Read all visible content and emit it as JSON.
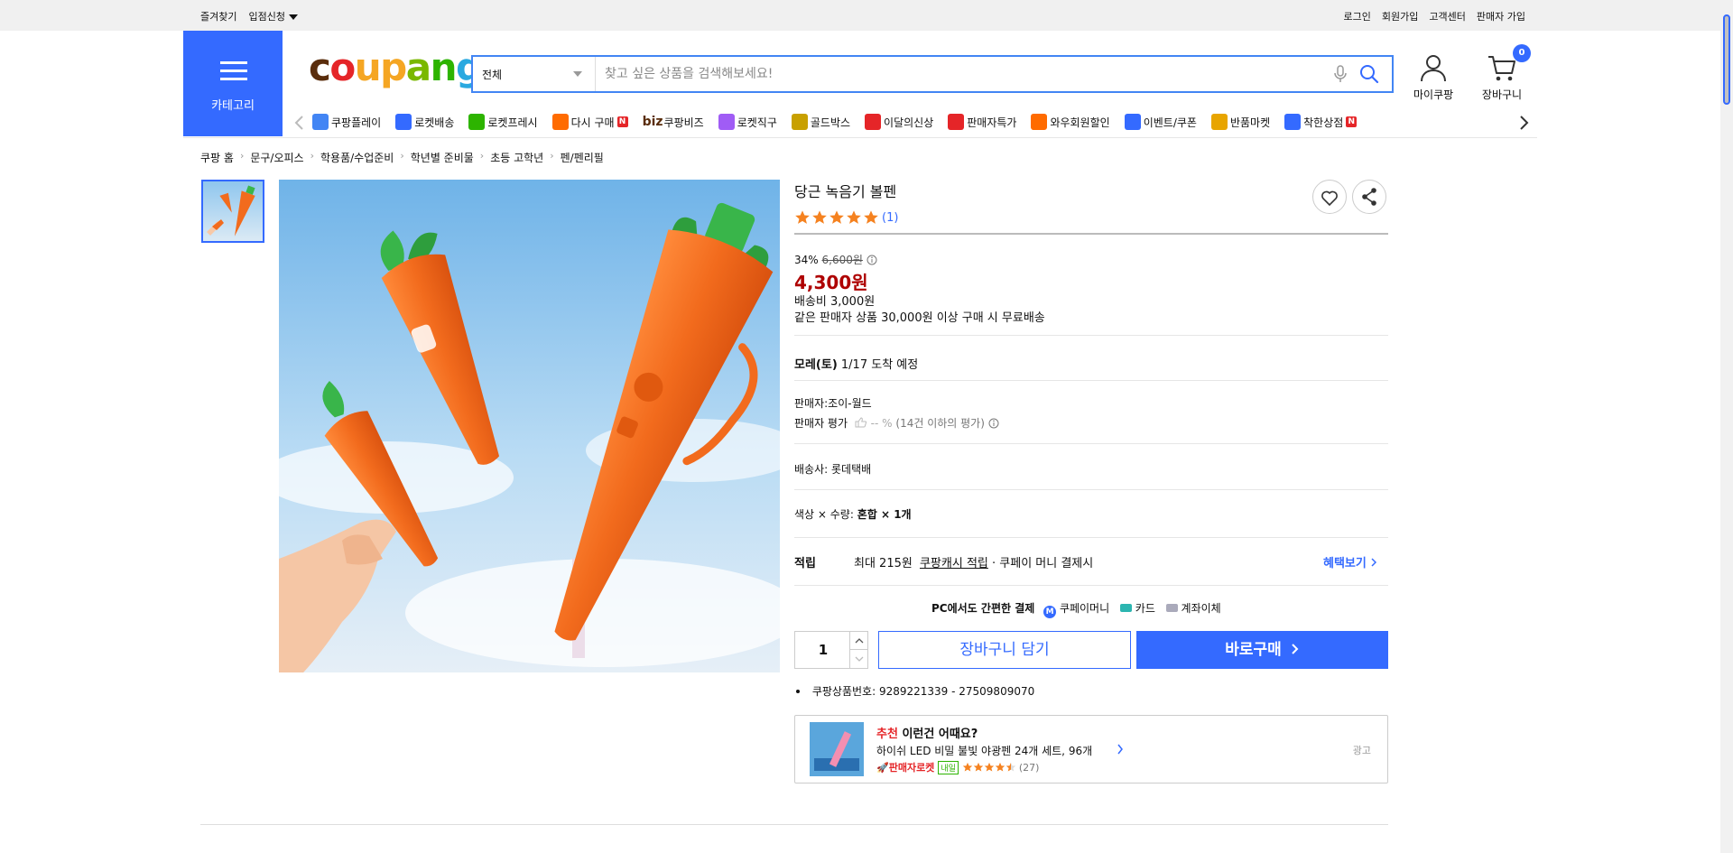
{
  "topbar": {
    "favorite": "즐겨찾기",
    "seller_apply": "입점신청",
    "login": "로그인",
    "signup": "회원가입",
    "cs": "고객센터",
    "seller_signup": "판매자 가입"
  },
  "header": {
    "category_label": "카테고리",
    "logo": {
      "c1": "c",
      "o1": "o",
      "u": "u",
      "p": "p",
      "a": "a",
      "n": "n",
      "g": "g"
    },
    "search_select": "전체",
    "search_placeholder": "찾고 싶은 상품을 검색해보세요!",
    "mycoupang": "마이쿠팡",
    "cart": "장바구니",
    "cart_count": "0"
  },
  "nav": {
    "items": [
      {
        "label": "쿠팡플레이",
        "color": "#4285f4"
      },
      {
        "label": "로켓배송",
        "color": "#346aff"
      },
      {
        "label": "로켓프레시",
        "color": "#2db400"
      },
      {
        "label": "다시 구매",
        "color": "#ff6b00"
      },
      {
        "label": "쿠팡비즈",
        "color": "#5a2d0c"
      },
      {
        "label": "로켓직구",
        "color": "#a05cf5"
      },
      {
        "label": "골드박스",
        "color": "#c8a000"
      },
      {
        "label": "이달의신상",
        "color": "#e52528"
      },
      {
        "label": "판매자특가",
        "color": "#e52528"
      },
      {
        "label": "와우회원할인",
        "color": "#ff6b00"
      },
      {
        "label": "이벤트/쿠폰",
        "color": "#346aff"
      },
      {
        "label": "반품마켓",
        "color": "#e8a500"
      },
      {
        "label": "착한상점",
        "color": "#346aff"
      }
    ],
    "biz_prefix": "biz",
    "new_badge": "N"
  },
  "breadcrumb": [
    "쿠팡 홈",
    "문구/오피스",
    "학용품/수업준비",
    "학년별 준비물",
    "초등 고학년",
    "펜/펜리필"
  ],
  "product": {
    "title": "당근 녹음기 볼펜",
    "rating_count": "(1)",
    "rating": 5,
    "discount_rate": "34%",
    "original_price": "6,600원",
    "price": "4,300원",
    "shipping_fee": "배송비 3,000원",
    "free_shipping_note": "같은 판매자 상품 30,000원 이상 구매 시 무료배송",
    "arrival_day": "모레(토)",
    "arrival_date": "1/17 도착 예정",
    "seller_label": "판매자:",
    "seller": "조이-월드",
    "seller_rating_label": "판매자 평가",
    "seller_rating_value": "-- %",
    "seller_rating_note": "(14건 이하의 평가)",
    "courier_label": "배송사:",
    "courier": "롯데택배",
    "option_label": "색상 × 수량:",
    "option_value": "혼합 × 1개",
    "reward_label": "적립",
    "reward_max": "최대 215원",
    "reward_link": "쿠팡캐시 적립",
    "reward_tail": "· 쿠페이 머니 결제시",
    "benefit_link": "혜택보기",
    "pay_title": "PC에서도 간편한 결제",
    "pay_money": "쿠페이머니",
    "pay_card": "카드",
    "pay_bank": "계좌이체",
    "quantity": "1",
    "add_to_cart": "장바구니 담기",
    "buy_now": "바로구매",
    "product_no_label": "쿠팡상품번호:",
    "product_no": "9289221339 - 27509809070"
  },
  "recommend": {
    "title_accent": "추천",
    "title": "이런건 어때요?",
    "item_name": "하이쉬 LED 비밀 불빛 야광펜 24개 세트, 96개",
    "badge_seller": "판매자로켓",
    "badge_tomorrow": "내일",
    "rating": 4.5,
    "rating_count": "(27)",
    "ad_label": "광고"
  },
  "colors": {
    "accent": "#346aff",
    "price_red": "#ae0000",
    "star": "#f58220"
  }
}
